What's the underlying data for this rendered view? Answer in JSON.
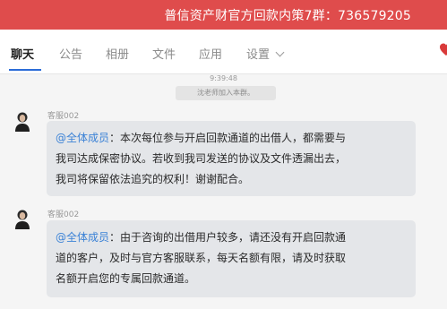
{
  "window": {
    "title": "普信资产财官方回款内策7群：736579205"
  },
  "tabs": [
    {
      "label": "聊天",
      "active": true
    },
    {
      "label": "公告",
      "active": false
    },
    {
      "label": "相册",
      "active": false
    },
    {
      "label": "文件",
      "active": false
    },
    {
      "label": "应用",
      "active": false
    },
    {
      "label": "设置",
      "active": false
    }
  ],
  "chat": {
    "timestamp": "9:39:48",
    "system_message": "沈老师加入本群。",
    "messages": [
      {
        "sender": "客服002",
        "mention": "@全体成员",
        "lines": [
          "：本次每位参与开启回款通道的出借人，都需要与",
          "我司达成保密协议。若收到我司发送的协议及文件透漏出去，",
          "我司将保留依法追究的权利！谢谢配合。"
        ]
      },
      {
        "sender": "客服002",
        "mention": "@全体成员",
        "lines": [
          "：由于咨询的出借用户较多，请还没有开启回款通",
          "道的客户，及时与官方客服联系，每天名额有限，请及时获取",
          "名额开启您的专属回款通道。"
        ]
      }
    ]
  },
  "colors": {
    "titlebar": "#df4c4c",
    "mention": "#3b82d6",
    "bubble": "#e4e6e9",
    "chat_background": "#f5f5f5"
  }
}
